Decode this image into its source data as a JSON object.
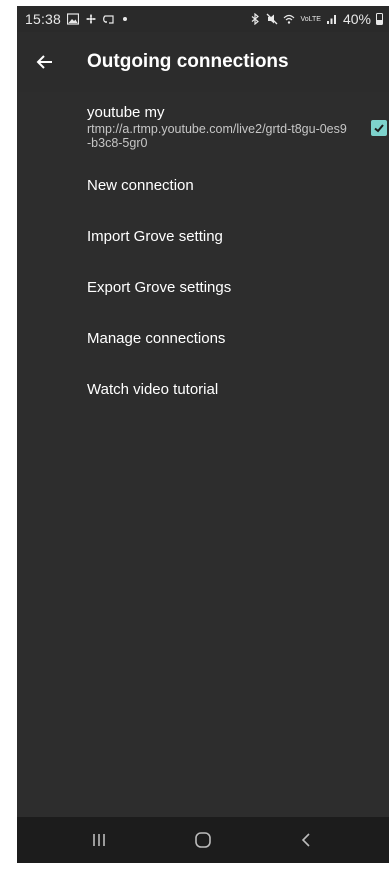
{
  "status_bar": {
    "time": "15:38",
    "network_label": "VoLTE",
    "battery_level": "40%"
  },
  "toolbar": {
    "title": "Outgoing connections"
  },
  "connections": [
    {
      "name": "youtube my",
      "url": "rtmp://a.rtmp.youtube.com/live2/grtd-t8gu-0es9-b3c8-5gr0",
      "checked": true
    }
  ],
  "menu": [
    {
      "label": "New connection"
    },
    {
      "label": "Import Grove setting"
    },
    {
      "label": "Export Grove settings"
    },
    {
      "label": "Manage connections"
    },
    {
      "label": "Watch video tutorial"
    }
  ],
  "colors": {
    "background": "#2d2d2d",
    "accent_checkbox": "#7ed3cd",
    "nav_bar": "#1c1c1c"
  }
}
